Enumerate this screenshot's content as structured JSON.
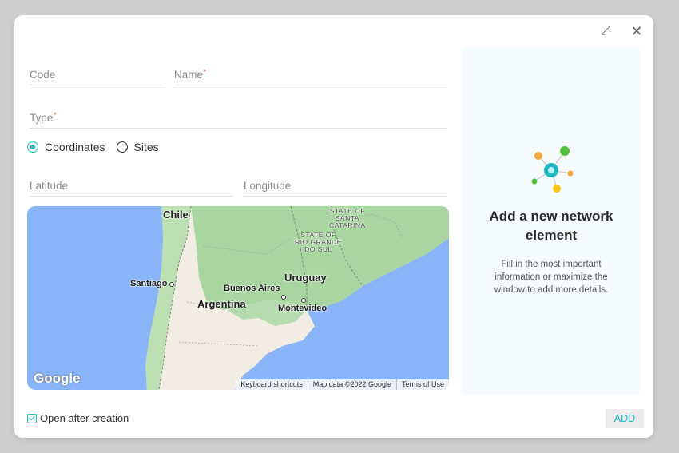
{
  "window": {
    "expand_icon": "expand-icon",
    "close_icon": "close-icon"
  },
  "form": {
    "code_label": "Code",
    "name_label": "Name",
    "type_label": "Type",
    "required_mark": "*",
    "radio_options": [
      "Coordinates",
      "Sites"
    ],
    "radio_selected": "Coordinates",
    "latitude_label": "Latitude",
    "longitude_label": "Longitude"
  },
  "map": {
    "labels": {
      "chile": "Chile",
      "santiago": "Santiago",
      "argentina": "Argentina",
      "buenos_aires": "Buenos Aires",
      "uruguay": "Uruguay",
      "montevideo": "Montevideo",
      "santa_catarina": "STATE OF\nSANTA\nCATARINA",
      "rio_grande": "STATE OF\nRIO GRANDE\nDO SUL"
    },
    "logo": "Google",
    "attribution": [
      "Keyboard shortcuts",
      "Map data ©2022 Google",
      "Terms of Use"
    ]
  },
  "panel": {
    "title": "Add a new network element",
    "description": "Fill in the most important information or maximize the window to add more details."
  },
  "footer": {
    "open_after_creation": "Open after creation",
    "add_button": "ADD"
  },
  "colors": {
    "accent": "#1cb7c4",
    "required": "#e2653f"
  }
}
